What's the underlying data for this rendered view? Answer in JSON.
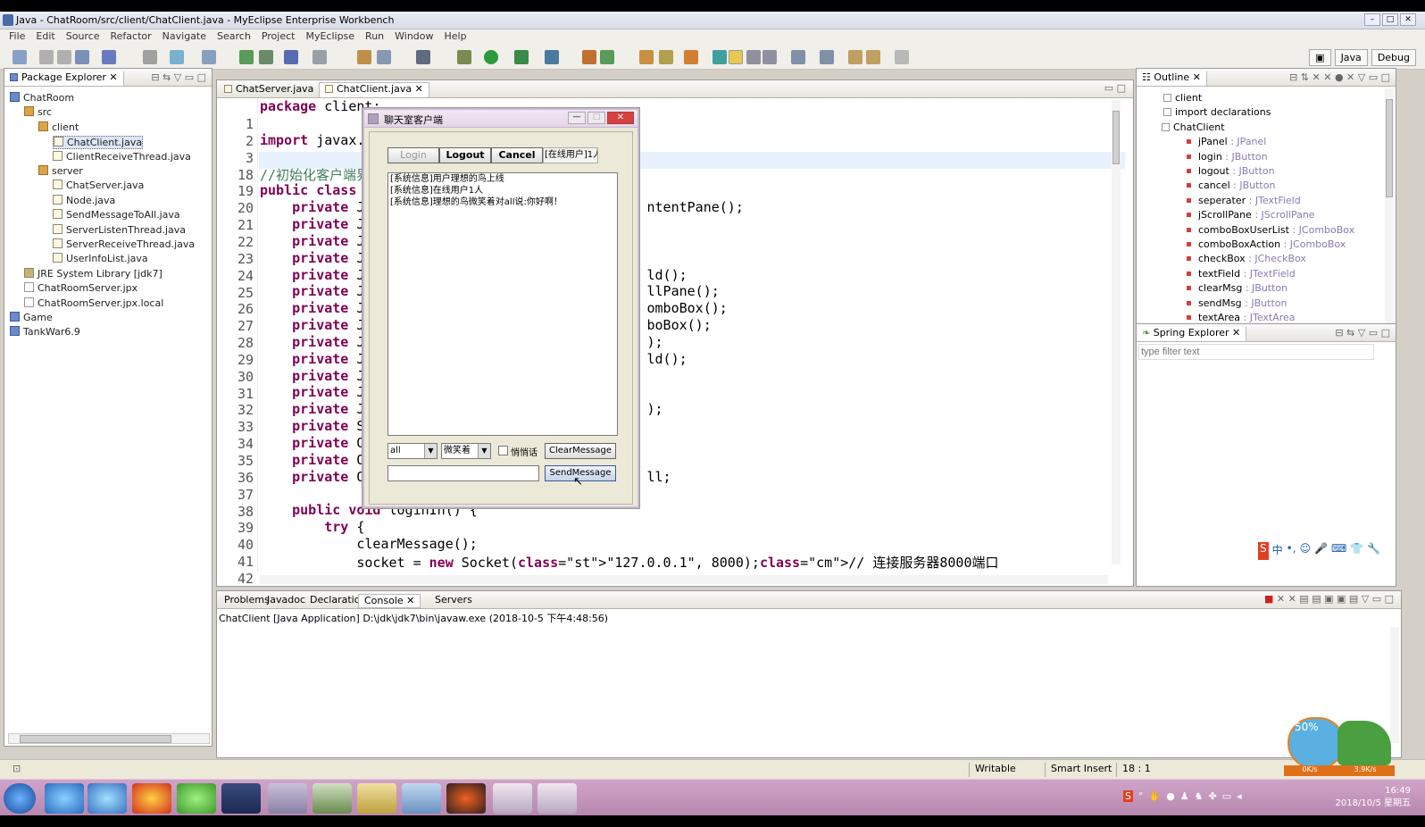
{
  "window": {
    "title": "Java - ChatRoom/src/client/ChatClient.java - MyEclipse Enterprise Workbench"
  },
  "menu": [
    "File",
    "Edit",
    "Source",
    "Refactor",
    "Navigate",
    "Search",
    "Project",
    "MyEclipse",
    "Run",
    "Window",
    "Help"
  ],
  "perspectives": {
    "java": "Java",
    "debug": "Debug"
  },
  "package_explorer": {
    "tab": "Package Explorer",
    "tree": [
      {
        "label": "ChatRoom",
        "indent": 0,
        "icon": "proj"
      },
      {
        "label": "src",
        "indent": 1,
        "icon": "pkg"
      },
      {
        "label": "client",
        "indent": 2,
        "icon": "pkg"
      },
      {
        "label": "ChatClient.java",
        "indent": 3,
        "icon": "java"
      },
      {
        "label": "ClientReceiveThread.java",
        "indent": 3,
        "icon": "java"
      },
      {
        "label": "server",
        "indent": 2,
        "icon": "pkg"
      },
      {
        "label": "ChatServer.java",
        "indent": 3,
        "icon": "java"
      },
      {
        "label": "Node.java",
        "indent": 3,
        "icon": "java"
      },
      {
        "label": "SendMessageToAll.java",
        "indent": 3,
        "icon": "java"
      },
      {
        "label": "ServerListenThread.java",
        "indent": 3,
        "icon": "java"
      },
      {
        "label": "ServerReceiveThread.java",
        "indent": 3,
        "icon": "java"
      },
      {
        "label": "UserInfoList.java",
        "indent": 3,
        "icon": "java"
      },
      {
        "label": "JRE System Library [jdk7]",
        "indent": 1,
        "icon": "lib"
      },
      {
        "label": "ChatRoomServer.jpx",
        "indent": 1,
        "icon": "file"
      },
      {
        "label": "ChatRoomServer.jpx.local",
        "indent": 1,
        "icon": "file"
      },
      {
        "label": "Game",
        "indent": 0,
        "icon": "proj"
      },
      {
        "label": "TankWar6.9",
        "indent": 0,
        "icon": "proj"
      }
    ]
  },
  "editor": {
    "tabs": [
      "ChatServer.java",
      "ChatClient.java"
    ],
    "lines": [
      {
        "n": "1",
        "code": "package client;"
      },
      {
        "n": "2",
        "code": ""
      },
      {
        "n": "3",
        "code": "import javax."
      },
      {
        "n": "18",
        "code": ""
      },
      {
        "n": "19",
        "code": "//初始化客户端界面"
      },
      {
        "n": "20",
        "code": "public class"
      },
      {
        "n": "21",
        "code": "    private J                                   ntentPane();"
      },
      {
        "n": "22",
        "code": "    private J"
      },
      {
        "n": "23",
        "code": "    private J"
      },
      {
        "n": "24",
        "code": "    private J"
      },
      {
        "n": "25",
        "code": "    private J                                   ld();"
      },
      {
        "n": "26",
        "code": "    private J                                   llPane();"
      },
      {
        "n": "27",
        "code": "    private J                                   omboBox();"
      },
      {
        "n": "28",
        "code": "    private J                                   boBox();"
      },
      {
        "n": "29",
        "code": "    private J                                   );"
      },
      {
        "n": "30",
        "code": "    private J                                   ld();"
      },
      {
        "n": "31",
        "code": "    private J"
      },
      {
        "n": "32",
        "code": "    private J"
      },
      {
        "n": "33",
        "code": "    private J                                   );"
      },
      {
        "n": "34",
        "code": "    private S"
      },
      {
        "n": "35",
        "code": "    private O"
      },
      {
        "n": "36",
        "code": "    private O"
      },
      {
        "n": "37",
        "code": "    private O                                   ll;"
      },
      {
        "n": "38",
        "code": ""
      },
      {
        "n": "39",
        "code": "    public void loginIn() {"
      },
      {
        "n": "40",
        "code": "        try {"
      },
      {
        "n": "41",
        "code": "            clearMessage();"
      },
      {
        "n": "42",
        "code": "            socket = new Socket(\"127.0.0.1\", 8000);// 连接服务器8000端口"
      }
    ]
  },
  "dialog": {
    "title": "聊天室客户端",
    "login": "Login",
    "logout": "Logout",
    "cancel": "Cancel",
    "online": "[在线用户]1人",
    "messages": [
      "[系统信息]用户理想的鸟上线",
      "[系统信息]在线用户1人",
      "[系统信息]理想的鸟微笑着对all说:你好啊！"
    ],
    "target": "all",
    "action": "微笑着",
    "whisper": "悄悄话",
    "clear": "ClearMessage",
    "send": "SendMessage",
    "input_value": ""
  },
  "outline": {
    "tab": "Outline",
    "items": [
      {
        "name": "client",
        "type": ""
      },
      {
        "name": "import declarations",
        "type": ""
      },
      {
        "name": "ChatClient",
        "type": ""
      },
      {
        "name": "jPanel",
        "type": " : JPanel"
      },
      {
        "name": "login",
        "type": " : JButton"
      },
      {
        "name": "logout",
        "type": " : JButton"
      },
      {
        "name": "cancel",
        "type": " : JButton"
      },
      {
        "name": "seperater",
        "type": " : JTextField"
      },
      {
        "name": "jScrollPane",
        "type": " : JScrollPane"
      },
      {
        "name": "comboBoxUserList",
        "type": " : JComboBox"
      },
      {
        "name": "comboBoxAction",
        "type": " : JComboBox"
      },
      {
        "name": "checkBox",
        "type": " : JCheckBox"
      },
      {
        "name": "textField",
        "type": " : JTextField"
      },
      {
        "name": "clearMsg",
        "type": " : JButton"
      },
      {
        "name": "sendMsg",
        "type": " : JButton"
      },
      {
        "name": "textArea",
        "type": " : JTextArea"
      }
    ]
  },
  "spring": {
    "tab": "Spring Explorer",
    "filter_placeholder": "type filter text"
  },
  "console": {
    "tabs": [
      "Problems",
      "Javadoc",
      "Declaration",
      "Console",
      "Servers"
    ],
    "header": "ChatClient [Java Application] D:\\jdk\\jdk7\\bin\\javaw.exe (2018-10-5 下午4:48:56)"
  },
  "status": {
    "writable": "Writable",
    "insert": "Smart Insert",
    "pos": "18 : 1"
  },
  "tray": {
    "time": "16:49",
    "date": "2018/10/5 星期五",
    "widget_pct": "50%",
    "up": "0K/s",
    "down": "3.9K/s"
  },
  "colors": {
    "keyword": "#7f0055",
    "comment": "#3f7f5f",
    "string": "#2a00ff",
    "taskbar": "#c098b8"
  }
}
